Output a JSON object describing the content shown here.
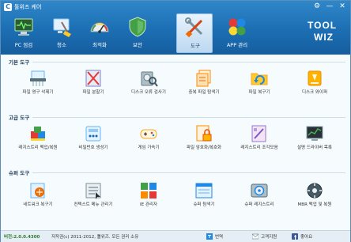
{
  "app": {
    "title": "툴위즈 케어",
    "icon_text": "C"
  },
  "window_controls": {
    "settings": "⚙",
    "minimize": "—",
    "close": "✕"
  },
  "nav": [
    {
      "label": "PC 점검",
      "icon": "pc-check-icon"
    },
    {
      "label": "청소",
      "icon": "cleaner-icon"
    },
    {
      "label": "최적화",
      "icon": "speedometer-icon"
    },
    {
      "label": "보안",
      "icon": "shield-icon"
    },
    {
      "label": "도구",
      "icon": "tools-icon",
      "active": true
    },
    {
      "label": "APP 관리",
      "icon": "apps-icon"
    }
  ],
  "logo": {
    "line1": "TOOL",
    "line2": "WIZ"
  },
  "sections": [
    {
      "title": "기본 도구",
      "tools": [
        {
          "label": "파일 영구 삭제기",
          "icon": "file-shredder-icon"
        },
        {
          "label": "파일 분할기",
          "icon": "file-splitter-icon"
        },
        {
          "label": "디스크 오류 검사기",
          "icon": "disk-check-icon"
        },
        {
          "label": "중복 파일 탐색기",
          "icon": "duplicate-finder-icon"
        },
        {
          "label": "파일 복구기",
          "icon": "file-recovery-icon"
        },
        {
          "label": "디스크 와이퍼",
          "icon": "disk-wiper-icon"
        }
      ]
    },
    {
      "title": "고급 도구",
      "tools": [
        {
          "label": "레지스트리 백업/복원",
          "icon": "registry-backup-icon"
        },
        {
          "label": "비밀번호 생성기",
          "icon": "password-generator-icon"
        },
        {
          "label": "게임 가속기",
          "icon": "game-booster-icon"
        },
        {
          "label": "파일 암호화/복호화",
          "icon": "file-encryption-icon"
        },
        {
          "label": "레지스트리 조각모음",
          "icon": "registry-defrag-icon"
        },
        {
          "label": "설명 드라이버 목록",
          "icon": "driver-list-icon"
        }
      ]
    },
    {
      "title": "슈퍼 도구",
      "tools": [
        {
          "label": "네트워크 복구기",
          "icon": "network-repair-icon"
        },
        {
          "label": "컨텍스트 메뉴 관리기",
          "icon": "context-menu-icon"
        },
        {
          "label": "IE 관리자",
          "icon": "ie-manager-icon"
        },
        {
          "label": "슈퍼 탐색기",
          "icon": "super-explorer-icon"
        },
        {
          "label": "슈퍼 레지스트리",
          "icon": "super-registry-icon"
        },
        {
          "label": "MBR 백업 및 복원",
          "icon": "mbr-backup-icon"
        }
      ]
    }
  ],
  "status": {
    "version": "버전:2.0.0.4300",
    "copyright": "저작권(c) 2011-2012, 툴위즈. 모든 권리 소유",
    "links": [
      {
        "label": "번역",
        "icon": "translate-icon"
      },
      {
        "label": "고객지원",
        "icon": "mail-icon"
      },
      {
        "label": "좋아요",
        "icon": "facebook-icon"
      }
    ]
  },
  "colors": {
    "header": "#1c6eb3",
    "accent": "#2a76bd",
    "background": "#f6fbfe"
  }
}
